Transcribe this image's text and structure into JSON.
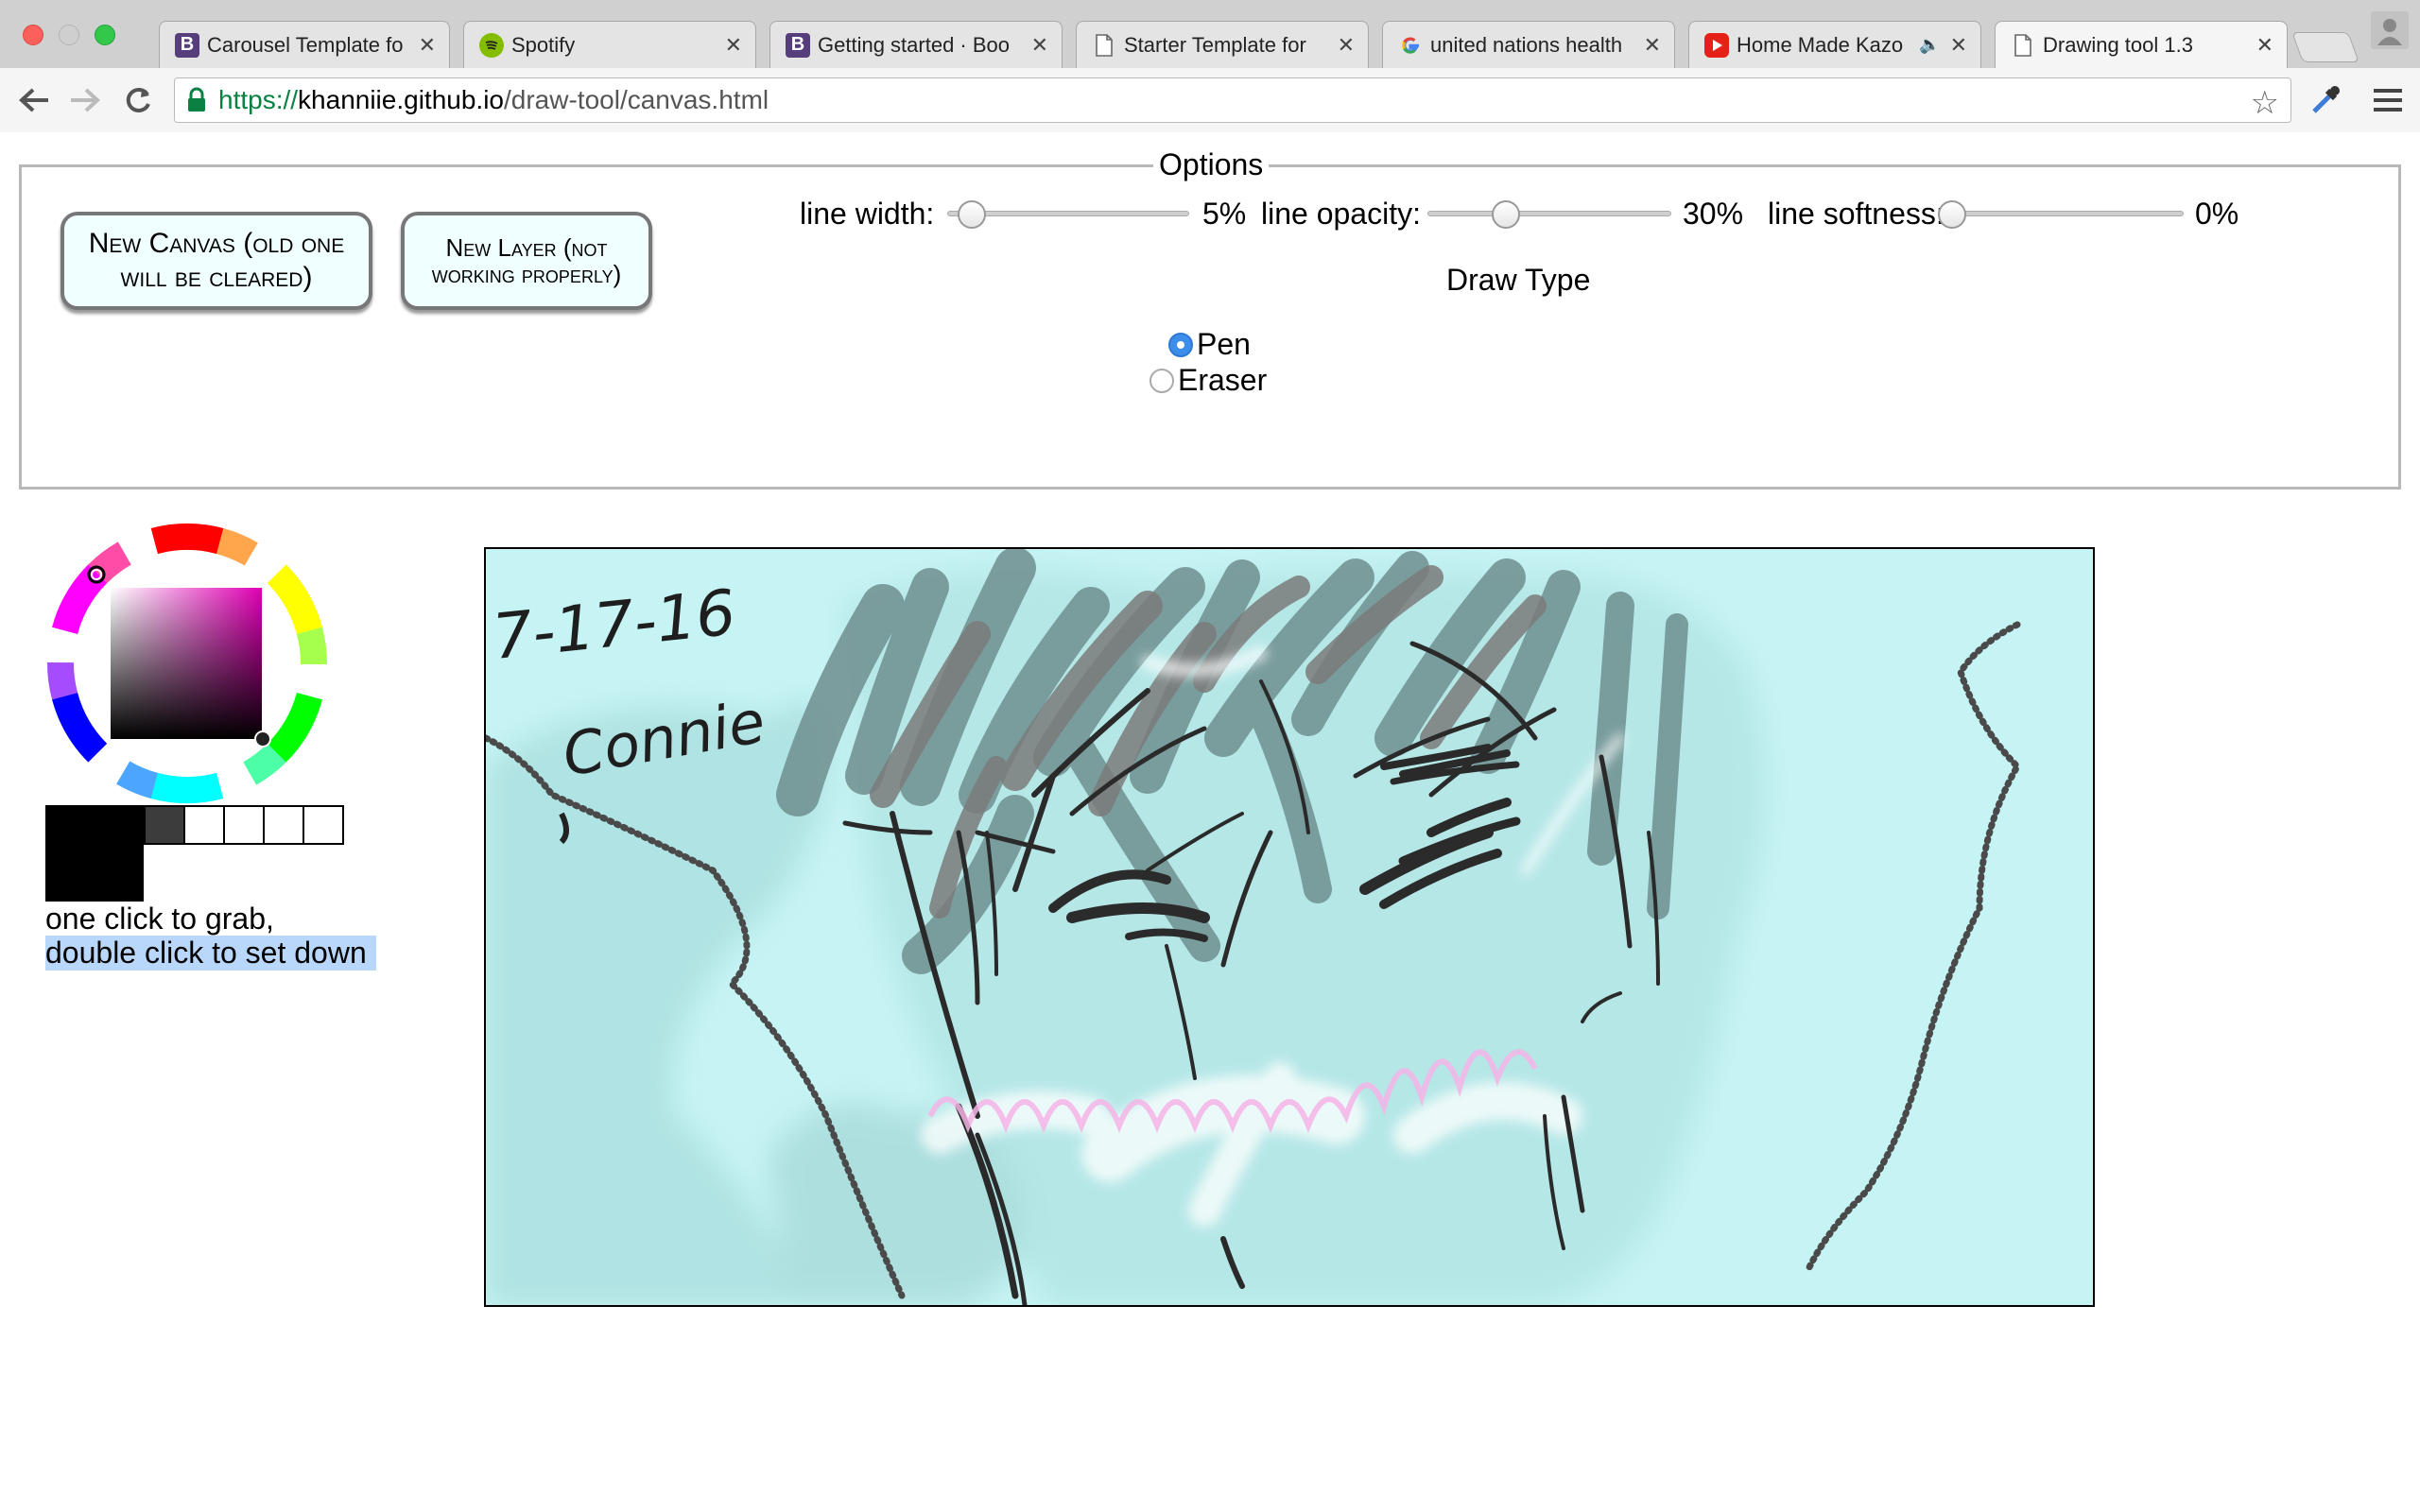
{
  "browser": {
    "tabs": [
      {
        "title": "Carousel Template fo",
        "favicon": "bootstrap-icon"
      },
      {
        "title": "Spotify",
        "favicon": "spotify-icon"
      },
      {
        "title": "Getting started · Boo",
        "favicon": "bootstrap-icon"
      },
      {
        "title": "Starter Template for",
        "favicon": "document-icon"
      },
      {
        "title": "united nations health",
        "favicon": "google-icon"
      },
      {
        "title": "Home Made Kazo",
        "favicon": "youtube-icon",
        "audio": true
      },
      {
        "title": "Drawing tool 1.3",
        "favicon": "document-icon",
        "active": true
      }
    ],
    "url": {
      "scheme": "https://",
      "host": "khanniie.github.io",
      "path": "/draw-tool/canvas.html"
    }
  },
  "options": {
    "legend": "Options",
    "new_canvas_label": "New Canvas (old one will be cleared)",
    "new_layer_label": "New Layer (not working properly)",
    "line_width": {
      "label": "line width:",
      "value_text": "5%",
      "value": 0.05
    },
    "line_opacity": {
      "label": "line opacity:",
      "value_text": "30%",
      "value": 0.3
    },
    "line_softness": {
      "label": "line softness:",
      "value_text": "0%",
      "value": 0.0
    },
    "draw_type_title": "Draw Type",
    "draw_types": [
      {
        "label": "Pen",
        "selected": true
      },
      {
        "label": "Eraser",
        "selected": false
      }
    ]
  },
  "palette": {
    "selected_color": "#000000",
    "swatches": [
      "#3c3c3c",
      "#ffffff",
      "#ffffff",
      "#ffffff",
      "#ffffff"
    ],
    "hint_line1": "one click to grab,",
    "hint_line2": "double click to set down"
  },
  "canvas": {
    "background": "#c6f3f3",
    "handwritten_date": "7-17-16",
    "handwritten_name": "Connie"
  },
  "colors": {
    "accent": "#3d8eea",
    "button_bg": "#f0ffff",
    "selection": "#b9d6fb"
  }
}
